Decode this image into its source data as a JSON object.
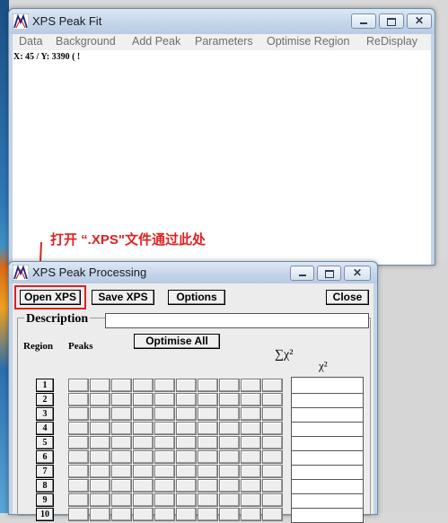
{
  "top_window": {
    "title": "XPS Peak Fit",
    "menu": [
      "Data",
      "Background",
      "Add Peak",
      "Parameters",
      "Optimise Region",
      "ReDisplay"
    ],
    "coords": "X: 45 / Y: 3390 ( !"
  },
  "annotation": {
    "text": "打开 “.XPS\"文件通过此处",
    "color": "#e02020"
  },
  "bottom_window": {
    "title": "XPS Peak Processing",
    "buttons": {
      "open": "Open XPS",
      "save": "Save XPS",
      "options": "Options",
      "close": "Close",
      "optimise_all": "Optimise All"
    },
    "description_label": "Description",
    "description_value": "",
    "region_header": "Region",
    "peaks_header": "Peaks",
    "sum_chi_label": "∑χ²",
    "chi_label": "χ²",
    "regions": [
      "1",
      "2",
      "3",
      "4",
      "5",
      "6",
      "7",
      "8",
      "9",
      "10"
    ]
  },
  "window_icons": [
    "xpspeak-app-icon",
    "minimize-icon",
    "maximize-icon",
    "close-icon"
  ]
}
